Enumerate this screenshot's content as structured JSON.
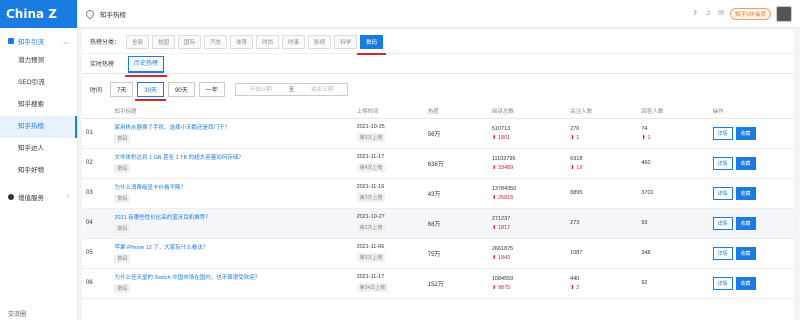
{
  "logo": "China Z .com",
  "sidebar": {
    "group1": "知乎引流",
    "items": [
      "潜力预测",
      "SEO引流",
      "知乎搜索",
      "知乎热榜",
      "知乎达人",
      "知乎好物"
    ],
    "group2": "增值服务",
    "footer": "交流圈"
  },
  "header": {
    "title": "知乎热榜",
    "vip_label": "知乎VIP会员"
  },
  "categories": {
    "label": "热榜分类：",
    "items": [
      "全部",
      "校园",
      "国际",
      "汽车",
      "体育",
      "时尚",
      "时事",
      "影视",
      "科学",
      "数码"
    ]
  },
  "tabs": [
    "实时热榜",
    "历史热榜"
  ],
  "timebar": {
    "label": "时间",
    "options": [
      "7天",
      "30天",
      "90天",
      "一年"
    ],
    "start_placeholder": "开始日期",
    "to": "至",
    "end_placeholder": "结束日期"
  },
  "table": {
    "headers": [
      "知乎标题",
      "上榜时间",
      "热度",
      "阅读总数",
      "关注人数",
      "回答人数",
      "操作"
    ],
    "rows": [
      {
        "idx": "01",
        "title": "家用热水器换了手机，选择小天鹅还是西门子？",
        "tag": "数码",
        "date": "2021-10-25",
        "times": "第3次上榜",
        "heat": "56万",
        "reads": "510713",
        "reads_inc": "1801",
        "follows": "270",
        "follows_inc": "1",
        "answers": "74",
        "answers_inc": "1"
      },
      {
        "idx": "02",
        "title": "文件体积达到 1 GB 甚至 1 TB 的超大容量如何存储？",
        "tag": "数码",
        "date": "2021-11-17",
        "times": "第4次上榜",
        "heat": "638万",
        "reads": "11103796",
        "reads_inc": "33489",
        "follows": "6918",
        "follows_inc": "19",
        "answers": "460",
        "answers_inc": ""
      },
      {
        "idx": "03",
        "title": "为什么消费级显卡价格不降？",
        "tag": "数码",
        "date": "2021-11-16",
        "times": "第3次上榜",
        "heat": "43万",
        "reads": "13784350",
        "reads_inc": "25815",
        "follows": "8895",
        "follows_inc": "",
        "answers": "3701",
        "answers_inc": ""
      },
      {
        "idx": "04",
        "title": "2021 有哪些性价比高的蓝牙耳机推荐？",
        "tag": "数码",
        "date": "2021-10-27",
        "times": "第2次上榜",
        "heat": "68万",
        "reads": "271237",
        "reads_inc": "1817",
        "follows": "273",
        "follows_inc": "",
        "answers": "93",
        "answers_inc": ""
      },
      {
        "idx": "05",
        "title": "苹果 iPhone 12 了，大家有什么看法？",
        "tag": "数码",
        "date": "2021-11-06",
        "times": "第3次上榜",
        "heat": "75万",
        "reads": "2661875",
        "reads_inc": "1843",
        "follows": "1087",
        "follows_inc": "",
        "answers": "348",
        "answers_inc": ""
      },
      {
        "idx": "06",
        "title": "为什么任天堂的 Switch 中国市场在国内，也不算很受欢迎？",
        "tag": "数码",
        "date": "2021-11-17",
        "times": "第34次上榜",
        "heat": "152万",
        "reads": "1084559",
        "reads_inc": "9875",
        "follows": "440",
        "follows_inc": "2",
        "answers": "92",
        "answers_inc": ""
      }
    ],
    "op_detail": "详情",
    "op_collect": "收藏"
  },
  "colors": {
    "accent": "#1a7be0",
    "highlight": "#d9232d"
  }
}
